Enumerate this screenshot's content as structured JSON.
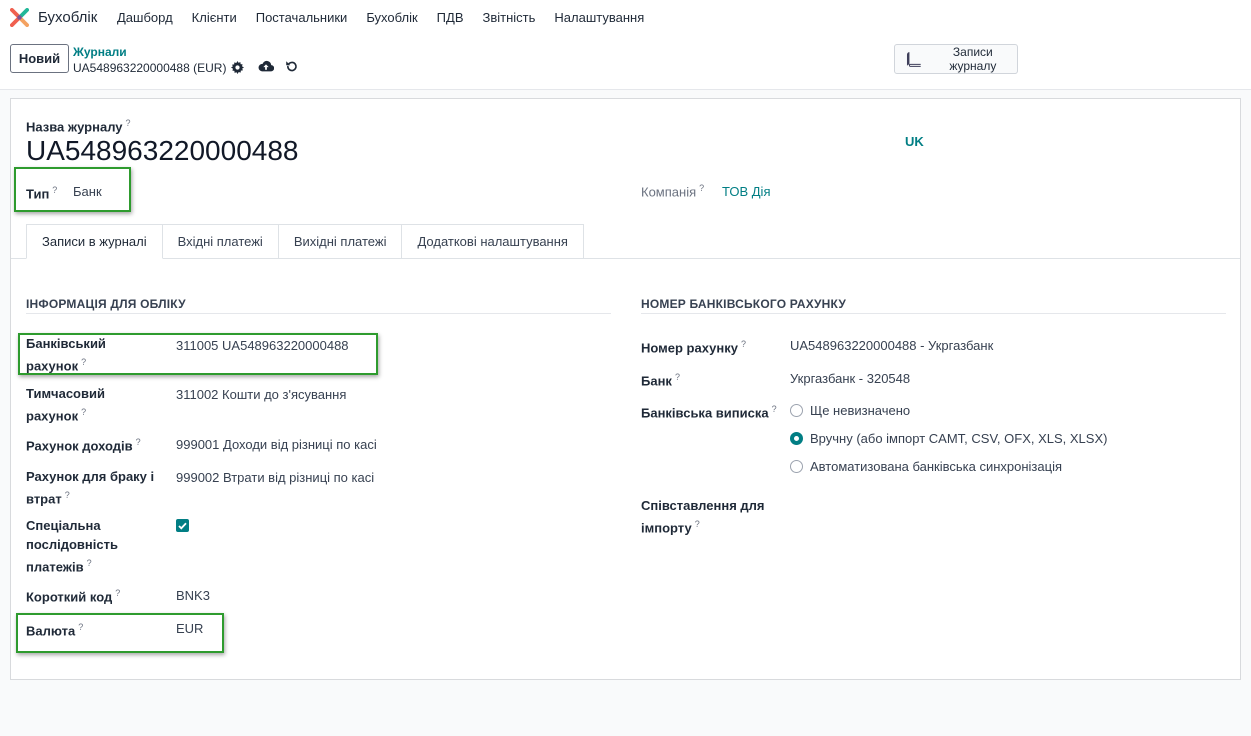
{
  "app": {
    "name": "Бухоблік",
    "menu": [
      "Дашборд",
      "Клієнти",
      "Постачальники",
      "Бухоблік",
      "ПДВ",
      "Звітність",
      "Налаштування"
    ]
  },
  "control_panel": {
    "new_button": "Новий",
    "breadcrumb": "Журнали",
    "record": "UA548963220000488 (EUR)",
    "journal_entries_button": "Записи журналу"
  },
  "form": {
    "name_label": "Назва журналу",
    "name_value": "UA548963220000488",
    "lang_badge": "UK",
    "type_label": "Тип",
    "type_value": "Банк",
    "company_label": "Компанія",
    "company_value": "ТОВ Дія",
    "help_mark": "?"
  },
  "tabs": [
    "Записи в журналі",
    "Вхідні платежі",
    "Вихідні платежі",
    "Додаткові налаштування"
  ],
  "accounting": {
    "title": "ІНФОРМАЦІЯ ДЛЯ ОБЛІКУ",
    "bank_account_label_1": "Банківський",
    "bank_account_label_2": "рахунок",
    "bank_account_value": "311005 UA548963220000488",
    "suspense_label_1": "Тимчасовий",
    "suspense_label_2": "рахунок",
    "suspense_value": "311002 Кошти до з'ясування",
    "profit_label": "Рахунок доходів",
    "profit_value": "999001 Доходи від різниці по касі",
    "loss_label_1": "Рахунок для браку і",
    "loss_label_2": "втрат",
    "loss_value": "999002 Втрати від різниці по касі",
    "sequence_label_1": "Спеціальна",
    "sequence_label_2": "послідовність",
    "sequence_label_3": "платежів",
    "sequence_checked": true,
    "code_label": "Короткий код",
    "code_value": "BNK3",
    "currency_label": "Валюта",
    "currency_value": "EUR"
  },
  "bank": {
    "title": "НОМЕР БАНКІВСЬКОГО РАХУНКУ",
    "account_number_label": "Номер рахунку",
    "account_number_value": "UA548963220000488 - Укргазбанк",
    "bank_label": "Банк",
    "bank_value": "Укргазбанк - 320548",
    "statement_label": "Банківська виписка",
    "statement_options": [
      "Ще невизначено",
      "Вручну (або імпорт CAMT, CSV, OFX, XLS, XLSX)",
      "Автоматизована банківська синхронізація"
    ],
    "statement_selected": 1,
    "mapping_label_1": "Співставлення для",
    "mapping_label_2": "імпорту"
  },
  "colors": {
    "accent": "#017e84",
    "highlight": "#2e9b2e"
  }
}
